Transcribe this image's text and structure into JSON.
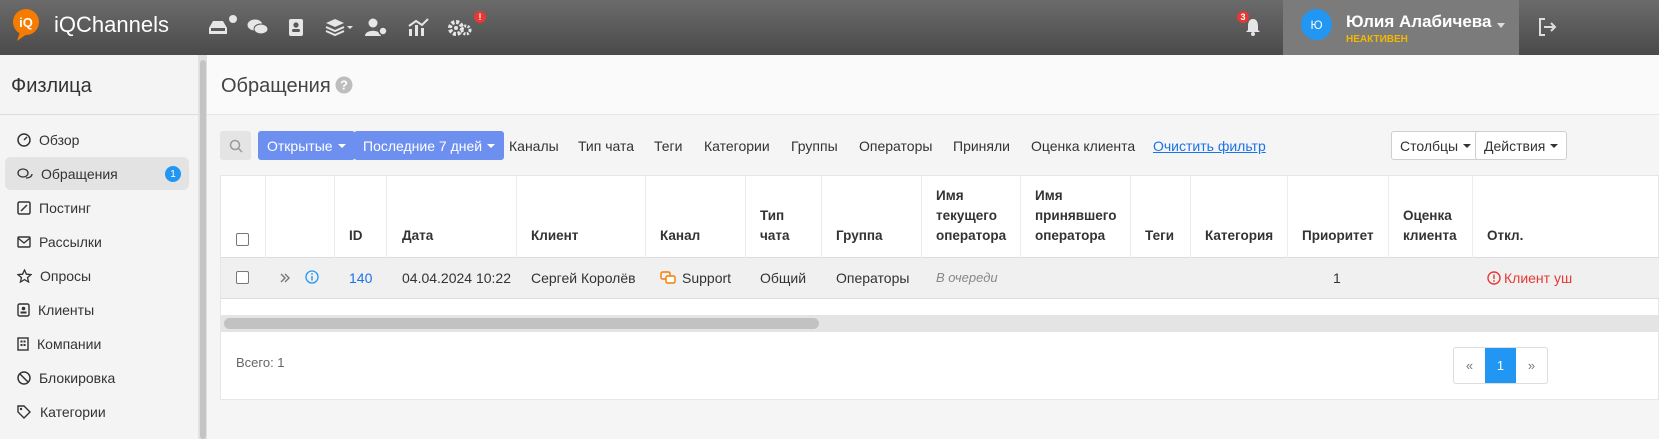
{
  "app": {
    "brand": "iQChannels"
  },
  "topbar": {
    "notification_count": "3",
    "settings_alert": "!",
    "user": {
      "initials": "Ю",
      "name": "Юлия Алабичева",
      "status": "НЕАКТИВЕН"
    }
  },
  "sidebar": {
    "title": "Физлица",
    "items": [
      {
        "label": "Обзор",
        "icon": "dashboard-icon"
      },
      {
        "label": "Обращения",
        "icon": "chat-icon",
        "badge": "1",
        "active": true
      },
      {
        "label": "Постинг",
        "icon": "edit-icon"
      },
      {
        "label": "Рассылки",
        "icon": "mail-icon"
      },
      {
        "label": "Опросы",
        "icon": "star-icon"
      },
      {
        "label": "Клиенты",
        "icon": "contact-book-icon"
      },
      {
        "label": "Компании",
        "icon": "building-icon"
      },
      {
        "label": "Блокировка",
        "icon": "block-icon"
      },
      {
        "label": "Категории",
        "icon": "tags-icon"
      }
    ]
  },
  "page": {
    "title": "Обращения"
  },
  "filters": {
    "status": "Открытые",
    "period": "Последние 7 дней",
    "links": [
      "Каналы",
      "Тип чата",
      "Теги",
      "Категории",
      "Группы",
      "Операторы",
      "Приняли",
      "Оценка клиента"
    ],
    "clear": "Очистить фильтр",
    "columns": "Столбцы",
    "actions": "Действия"
  },
  "table": {
    "headers": {
      "id": "ID",
      "date": "Дата",
      "client": "Клиент",
      "channel": "Канал",
      "chat_type": "Тип чата",
      "group": "Группа",
      "current_operator": "Имя текущего оператора",
      "accepted_operator": "Имя принявшего оператора",
      "tags": "Теги",
      "category": "Категория",
      "priority": "Приоритет",
      "rating": "Оценка клиента",
      "rejected": "Откл."
    },
    "rows": [
      {
        "id": "140",
        "date": "04.04.2024 10:22",
        "client": "Сергей Королёв",
        "channel": "Support",
        "chat_type": "Общий",
        "group": "Операторы",
        "current_operator": "В очереди",
        "accepted_operator": "",
        "tags": "",
        "category": "",
        "priority": "1",
        "rating": "",
        "rejected": "Клиент уш"
      }
    ]
  },
  "footer": {
    "total": "Всего: 1",
    "pager": {
      "prev": "«",
      "current": "1",
      "next": "»"
    }
  },
  "colors": {
    "primary_blue": "#6d8ff0",
    "accent": "#2196f3",
    "danger": "#e53935",
    "status_yellow": "#f5b800"
  }
}
